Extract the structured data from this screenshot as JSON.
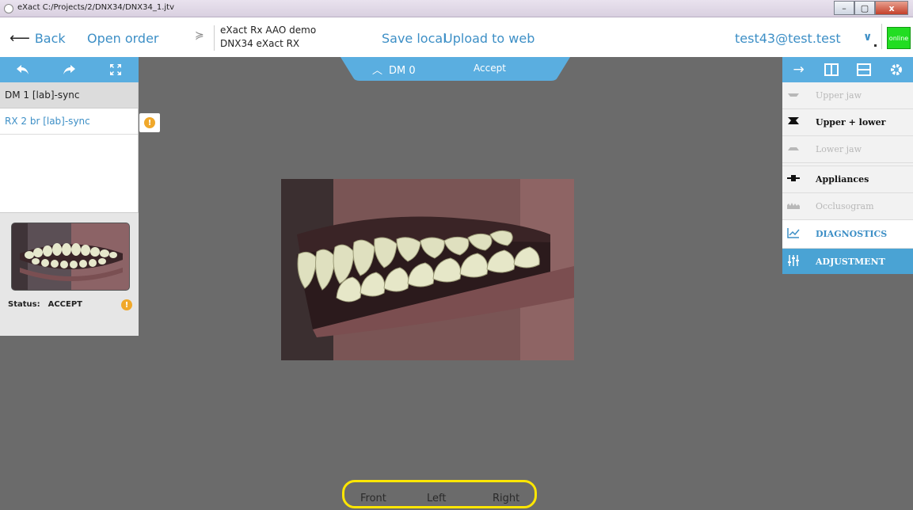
{
  "window": {
    "title": "eXact C:/Projects/2/DNX34/DNX34_1.jtv",
    "minimize": "–",
    "maximize": "▢",
    "close": "x"
  },
  "topbar": {
    "back_label": "Back",
    "open_order_label": "Open order",
    "case_line1": "eXact Rx AAO demo",
    "case_line2": "DNX34 eXact RX",
    "save_local_label": "Save local",
    "upload_label": "Upload to web",
    "user": "test43@test.test",
    "online_label": "online"
  },
  "left_panel": {
    "items": [
      {
        "label": "DM 1  [lab]-sync"
      },
      {
        "label": "RX 2 br [lab]-sync"
      }
    ],
    "status_key": "Status:",
    "status_value": "ACCEPT"
  },
  "dm_tab": {
    "label": "DM 0",
    "accept_label": "Accept"
  },
  "right_panel": {
    "items": [
      {
        "label": "Upper jaw",
        "icon": "upper-jaw-icon"
      },
      {
        "label": "Upper + lower",
        "icon": "upper-lower-icon"
      },
      {
        "label": "Lower jaw",
        "icon": "lower-jaw-icon"
      },
      {
        "label": "Appliances",
        "icon": "appliance-icon"
      },
      {
        "label": "Occlusogram",
        "icon": "occlusogram-icon"
      },
      {
        "label": "DIAGNOSTICS",
        "icon": "chart-icon"
      },
      {
        "label": "ADJUSTMENT",
        "icon": "sliders-icon"
      }
    ]
  },
  "views": {
    "front": "Front",
    "left": "Left",
    "right": "Right"
  },
  "colors": {
    "accent": "#5aaee0",
    "link": "#3d8fc6",
    "warning": "#f0a82a",
    "online": "#22dd22",
    "highlight": "#ffe600"
  }
}
